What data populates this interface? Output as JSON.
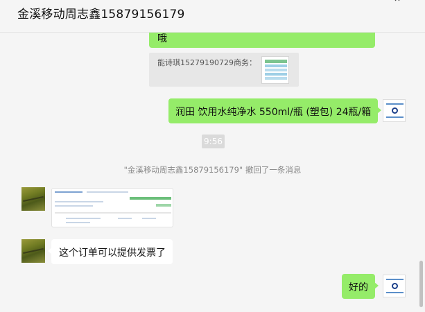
{
  "header": {
    "title": "金溪移动周志鑫15879156179",
    "pin_icon": "pin-icon",
    "close_icon": "close-icon"
  },
  "messages": {
    "partial_me": {
      "text": "哦"
    },
    "quote": {
      "text": "能诗琪15279190729商务：",
      "image_icon": "qr-code-image"
    },
    "product_me": {
      "text": "润田 饮用水纯净水 550ml/瓶 (塑包) 24瓶/箱"
    },
    "time": "9:56",
    "recall_notice": "\"金溪移动周志鑫15879156179\" 撤回了一条消息",
    "screenshot_other": {
      "type": "image",
      "icon": "order-screenshot-image"
    },
    "invoice_other": {
      "text": "这个订单可以提供发票了"
    },
    "reply_me": {
      "text": "好的"
    }
  },
  "colors": {
    "my_bubble": "#95ec69",
    "other_bubble": "#ffffff",
    "background": "#f5f5f5"
  }
}
